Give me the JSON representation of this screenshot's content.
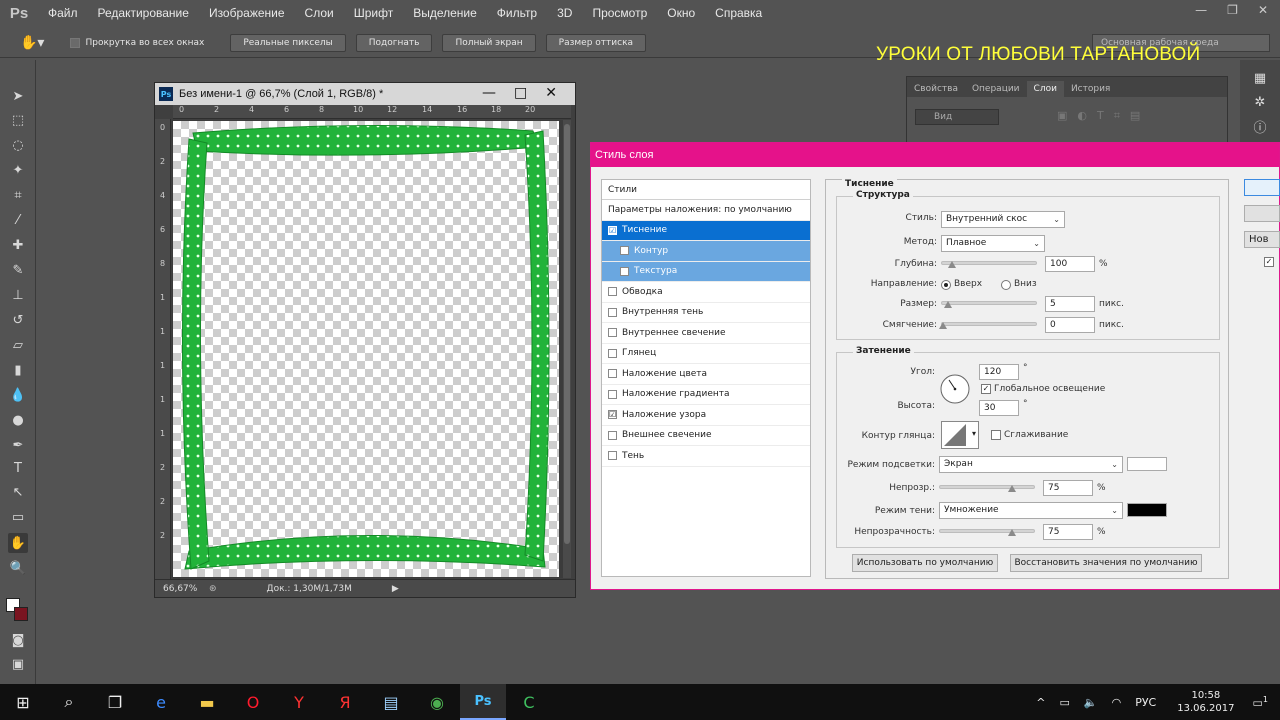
{
  "menu": {
    "logo": "Ps",
    "items": [
      "Файл",
      "Редактирование",
      "Изображение",
      "Слои",
      "Шрифт",
      "Выделение",
      "Фильтр",
      "3D",
      "Просмотр",
      "Окно",
      "Справка"
    ],
    "window_controls": [
      "—",
      "❐",
      "✕"
    ]
  },
  "options": {
    "scroll_all_label": "Прокрутка во всех окнах",
    "buttons": [
      "Реальные пикселы",
      "Подогнать",
      "Полный экран",
      "Размер оттиска"
    ],
    "workspace": "Основная рабочая среда"
  },
  "watermark": "УРОКИ ОТ ЛЮБОВИ ТАРТАНОВОЙ",
  "document": {
    "title": "Без имени-1 @ 66,7% (Слой 1, RGB/8) *",
    "ruler_top": [
      "0",
      "2",
      "4",
      "6",
      "8",
      "10",
      "12",
      "14",
      "16",
      "18",
      "20"
    ],
    "ruler_left": [
      "0",
      "2",
      "4",
      "6",
      "8",
      "1",
      "1",
      "1",
      "1",
      "1",
      "2",
      "2",
      "2"
    ],
    "zoom": "66,67%",
    "doc_size": "Док.: 1,30M/1,73M"
  },
  "panels": {
    "tabs": [
      "Свойства",
      "Операции",
      "Слои",
      "История"
    ],
    "active_tab": "Слои",
    "filter": "Вид"
  },
  "dialog": {
    "title": "Стиль слоя",
    "styles_header": "Стили",
    "blend_default": "Параметры наложения: по умолчанию",
    "styles": [
      {
        "label": "Тиснение",
        "checked": "☑",
        "kind": "selected"
      },
      {
        "label": "Контур",
        "checked": "",
        "kind": "sub"
      },
      {
        "label": "Текстура",
        "checked": "",
        "kind": "sub"
      },
      {
        "label": "Обводка",
        "checked": "",
        "kind": "normal"
      },
      {
        "label": "Внутренняя тень",
        "checked": "",
        "kind": "normal"
      },
      {
        "label": "Внутреннее свечение",
        "checked": "",
        "kind": "normal"
      },
      {
        "label": "Глянец",
        "checked": "",
        "kind": "normal"
      },
      {
        "label": "Наложение цвета",
        "checked": "",
        "kind": "normal"
      },
      {
        "label": "Наложение градиента",
        "checked": "",
        "kind": "normal"
      },
      {
        "label": "Наложение узора",
        "checked": "☑",
        "kind": "normal"
      },
      {
        "label": "Внешнее свечение",
        "checked": "",
        "kind": "normal"
      },
      {
        "label": "Тень",
        "checked": "",
        "kind": "normal"
      }
    ],
    "emboss": {
      "title": "Тиснение",
      "structure_title": "Структура",
      "style_label": "Стиль:",
      "style_value": "Внутренний скос",
      "method_label": "Метод:",
      "method_value": "Плавное",
      "depth_label": "Глубина:",
      "depth_value": "100",
      "depth_unit": "%",
      "direction_label": "Направление:",
      "direction_up": "Вверх",
      "direction_down": "Вниз",
      "size_label": "Размер:",
      "size_value": "5",
      "size_unit": "пикс.",
      "soften_label": "Смягчение:",
      "soften_value": "0",
      "soften_unit": "пикс.",
      "shading_title": "Затенение",
      "angle_label": "Угол:",
      "angle_value": "120",
      "degree": "°",
      "global_light": "Глобальное освещение",
      "altitude_label": "Высота:",
      "altitude_value": "30",
      "gloss_label": "Контур глянца:",
      "antialias": "Сглаживание",
      "highlight_label": "Режим подсветки:",
      "highlight_value": "Экран",
      "highlight_opacity_label": "Непрозр.:",
      "highlight_opacity": "75",
      "shadow_label": "Режим тени:",
      "shadow_value": "Умножение",
      "shadow_opacity_label": "Непрозрачность:",
      "shadow_opacity": "75",
      "pct": "%",
      "make_default": "Использовать по умолчанию",
      "reset_default": "Восстановить значения по умолчанию"
    },
    "side_new": "Нов"
  },
  "taskbar": {
    "lang": "РУС",
    "time": "10:58",
    "date": "13.06.2017",
    "notif": "1"
  },
  "colors": {
    "dialog_accent": "#e5128a",
    "selection": "#0a6fd1",
    "frame_green": "#22b33a",
    "watermark": "#ffff3a"
  }
}
